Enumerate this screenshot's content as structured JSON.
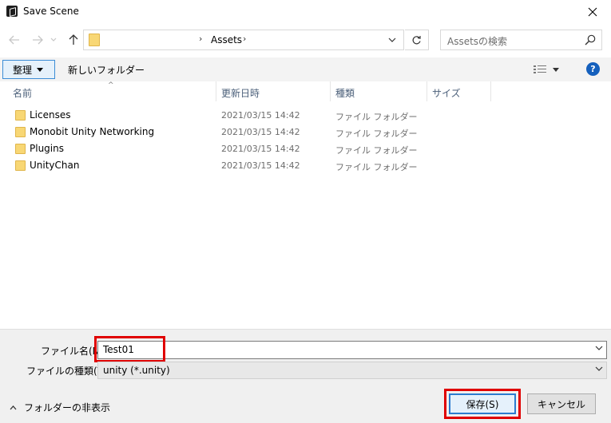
{
  "window": {
    "title": "Save Scene"
  },
  "nav": {
    "breadcrumb": [
      "Assets"
    ],
    "search_placeholder": "Assetsの検索"
  },
  "toolbar": {
    "organize_label": "整理",
    "new_folder_label": "新しいフォルダー"
  },
  "columns": [
    "名前",
    "更新日時",
    "種類",
    "サイズ"
  ],
  "files": [
    {
      "name": "Licenses",
      "modified": "2021/03/15 14:42",
      "type": "ファイル フォルダー"
    },
    {
      "name": "Monobit Unity Networking",
      "modified": "2021/03/15 14:42",
      "type": "ファイル フォルダー"
    },
    {
      "name": "Plugins",
      "modified": "2021/03/15 14:42",
      "type": "ファイル フォルダー"
    },
    {
      "name": "UnityChan",
      "modified": "2021/03/15 14:42",
      "type": "ファイル フォルダー"
    }
  ],
  "bottom": {
    "filename_label": "ファイル名(N):",
    "filename_value": "Test01",
    "filetype_label": "ファイルの種類(T):",
    "filetype_value": "unity (*.unity)",
    "hide_folders_label": "フォルダーの非表示",
    "save_label": "保存(S)",
    "cancel_label": "キャンセル"
  },
  "colors": {
    "highlight": "#e00000",
    "accent": "#1560bd",
    "folder": "#f8d775"
  }
}
